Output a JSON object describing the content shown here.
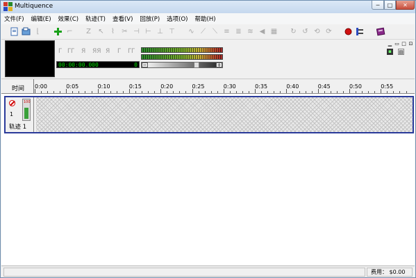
{
  "window": {
    "title": "Multiquence",
    "min_label": "─",
    "max_label": "□",
    "close_label": "✕"
  },
  "menu": [
    "文件(F)",
    "编辑(E)",
    "效果(C)",
    "轨迹(T)",
    "查看(V)",
    "回放(P)",
    "选项(O)",
    "帮助(H)"
  ],
  "toolbar": {
    "icons": [
      "new-icon",
      "open-icon",
      "save-icon",
      "add-track-icon",
      "remove-icon",
      "cut-icon",
      "copy-icon",
      "paste-icon",
      "scissors-icon",
      "record-icon",
      "settings-icon",
      "help-book-icon"
    ]
  },
  "transport": {
    "time": "00:00:00.000",
    "counter": "0",
    "volume_minus": "−",
    "volume_plus": "+",
    "volume_level": 0.66
  },
  "ruler": {
    "label": "时间",
    "ticks": [
      "0:00",
      "0:05",
      "0:10",
      "0:15",
      "0:20",
      "0:25",
      "0:30",
      "0:35",
      "0:40",
      "0:45",
      "0:50",
      "0:55"
    ]
  },
  "tracks": [
    {
      "name": "轨迹 1",
      "number": "1",
      "fader_label": "100"
    }
  ],
  "status": {
    "left": "",
    "cost": "费用： $0.00"
  },
  "colors": {
    "accent_track_border": "#2a3a9a",
    "time_display": "#00e000",
    "mute_red": "#d00000"
  }
}
